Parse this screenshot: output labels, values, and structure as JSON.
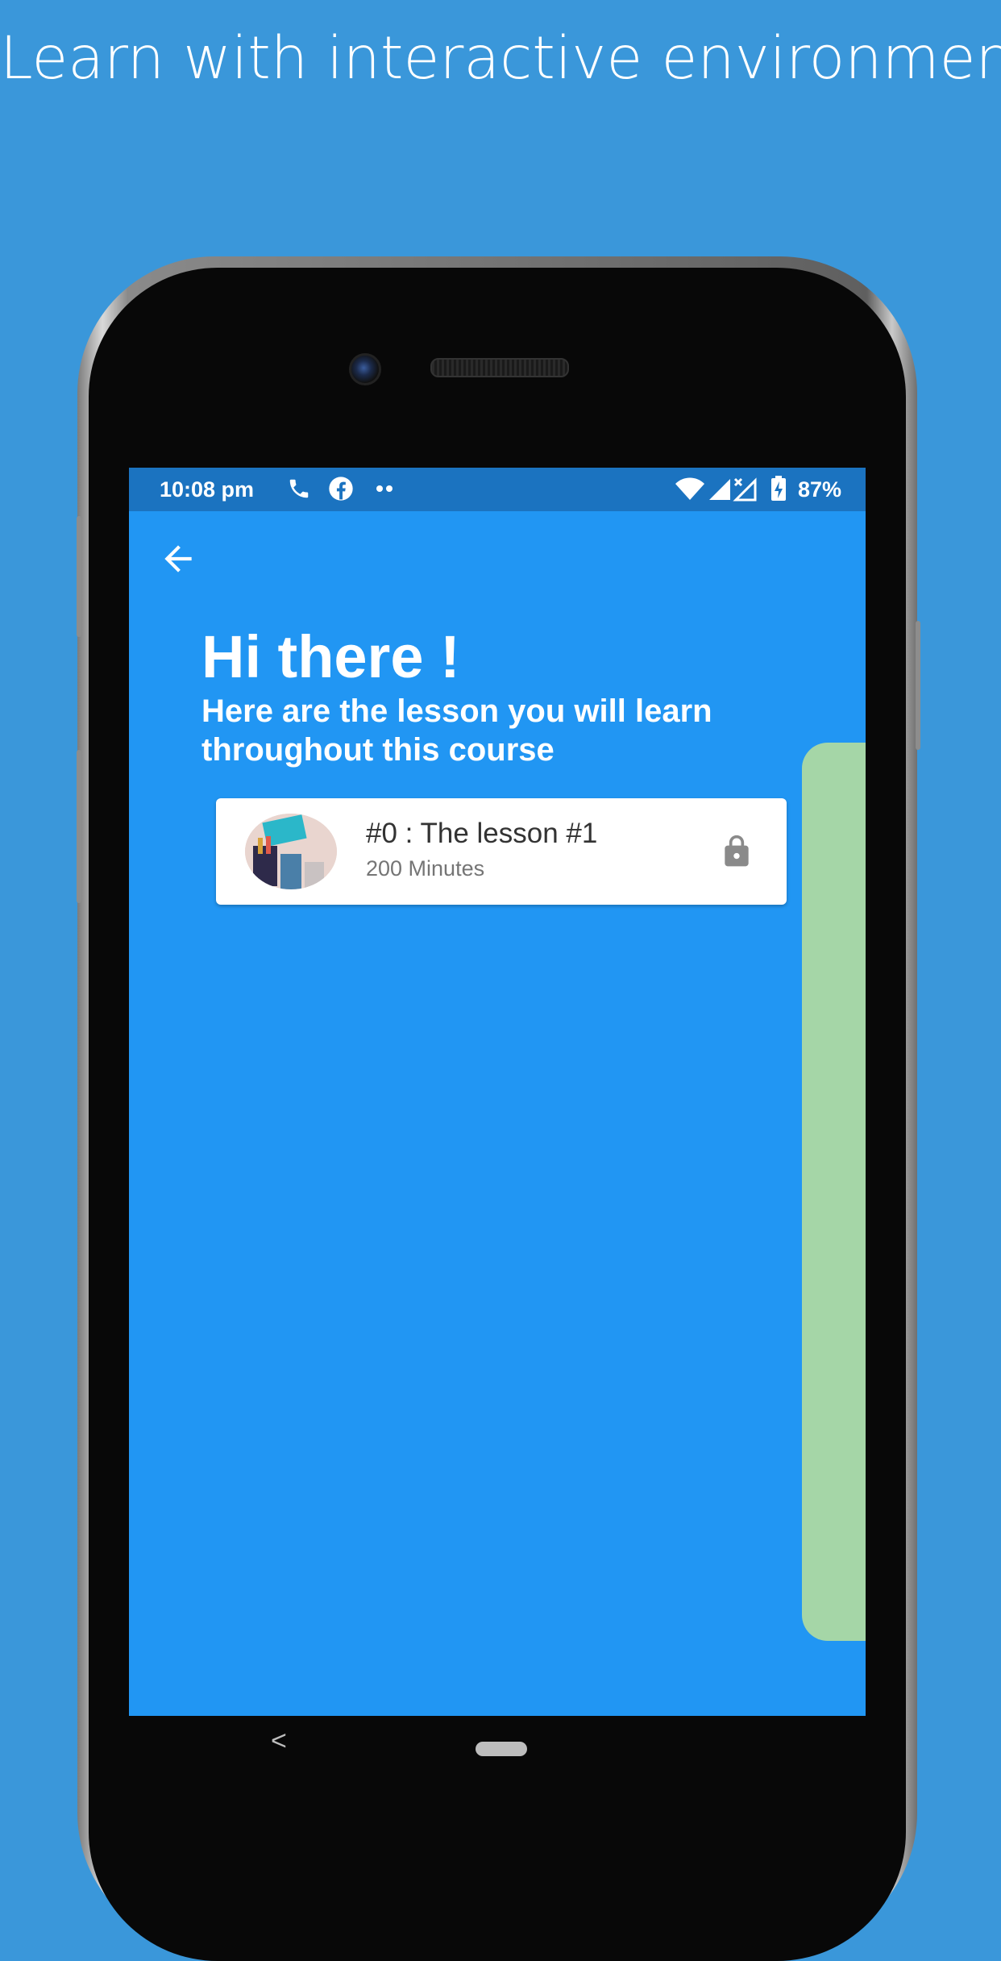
{
  "headline": "Learn with interactive environment",
  "status_bar": {
    "time": "10:08 pm",
    "battery": "87%",
    "icons": [
      "phone-icon",
      "facebook-icon",
      "more-dots-icon",
      "wifi-icon",
      "signal-icon",
      "no-signal-icon",
      "battery-charging-icon"
    ]
  },
  "header": {
    "back_icon": "arrow-left-icon",
    "greeting": "Hi there !",
    "subtitle": "Here are the lesson you will learn throughout this course"
  },
  "lessons": [
    {
      "title": "#0 : The lesson #1",
      "duration": "200 Minutes",
      "locked": true,
      "thumbnail_icon": "lesson-thumbnail",
      "lock_icon": "lock-icon"
    }
  ],
  "nav_bar": {
    "back_label": "<",
    "home_icon": "home-pill-icon"
  },
  "colors": {
    "page_background": "#3a97da",
    "screen_background": "#2196f3",
    "status_bar": "#1b73c0",
    "next_card": "#a5d6a7",
    "card": "#ffffff"
  }
}
